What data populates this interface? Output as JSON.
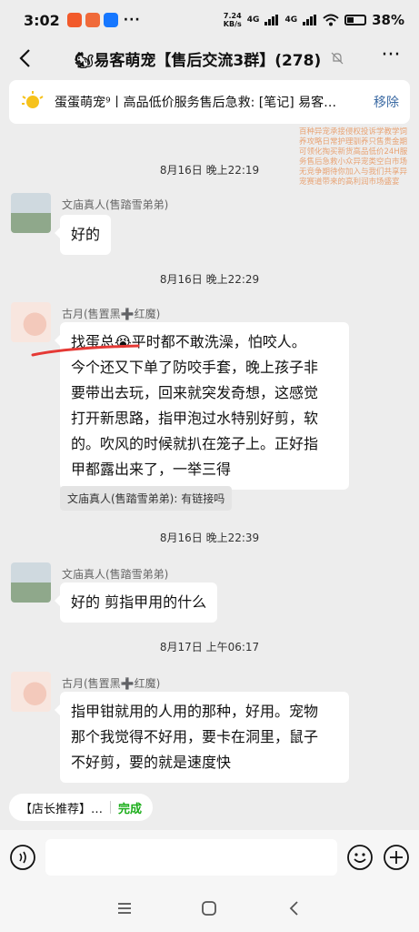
{
  "status_bar": {
    "time": "3:02",
    "speed_value": "7.24",
    "speed_unit": "KB/s",
    "signal_1": "4G",
    "signal_2": "4G",
    "battery_level": 0.38,
    "battery_text": "38%"
  },
  "header": {
    "title": "🐿易客萌宠【售后交流3群】(278)"
  },
  "pinned": {
    "text": "蛋蛋萌宠⁹丨高品低价服务售后急救: [笔记] 易客…",
    "remove_label": "移除"
  },
  "ad_text": "百种异宠承接侵权投诉学教学饲养攻略日常护理驯养只售贵金期可领化掏买新货高品低价24H服务售后急救小众异宠类空白市场无竞争期待你加入与我们共享异宠赛道带来的高利润市场盛宴",
  "messages": [
    {
      "type": "timestamp",
      "text": "8月16日 晚上22:19"
    },
    {
      "type": "message",
      "sender": "文庙真人(售踏雪弟弟)",
      "text": "好的"
    },
    {
      "type": "timestamp",
      "text": "8月16日 晚上22:29"
    },
    {
      "type": "message",
      "sender": "古月(售置黑➕红魔)",
      "lines": [
        "找蛋总😭平时都不敢洗澡，怕咬人。",
        "今个还又下单了防咬手套，晚上孩子非",
        "要带出去玩，回来就突发奇想，这感觉",
        "打开新思路，指甲泡过水特别好剪，软",
        "的。吹风的时候就扒在笼子上。正好指",
        "甲都露出来了，一举三得"
      ]
    },
    {
      "type": "quote",
      "text": "文庙真人(售踏雪弟弟): 有链接吗"
    },
    {
      "type": "timestamp",
      "text": "8月16日 晚上22:39"
    },
    {
      "type": "message",
      "sender": "文庙真人(售踏雪弟弟)",
      "text": "好的 剪指甲用的什么"
    },
    {
      "type": "timestamp",
      "text": "8月17日 上午06:17"
    },
    {
      "type": "message",
      "sender": "古月(售置黑➕红魔)",
      "lines": [
        "指甲钳就用的人用的那种，好用。宠物",
        "那个我觉得不好用，要卡在洞里，鼠子",
        "不好剪，要的就是速度快"
      ]
    }
  ],
  "shop_chip": {
    "label": "【店长推荐】…",
    "done": "完成"
  },
  "input": {
    "placeholder": ""
  }
}
